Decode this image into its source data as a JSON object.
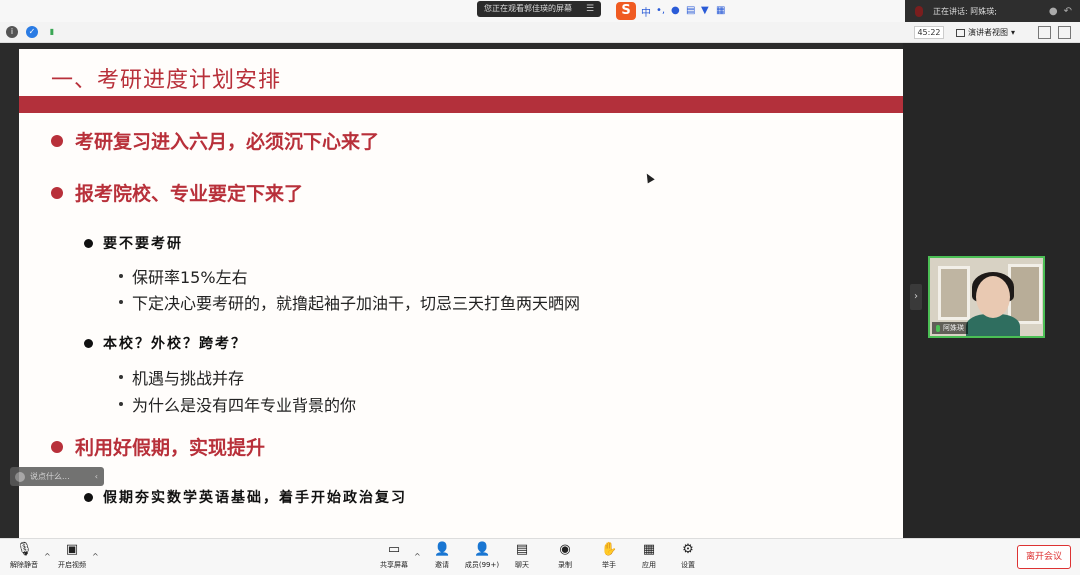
{
  "top": {
    "share_notice": "您正在观看郭佳瑛的屏幕",
    "share_menu": "☰",
    "ime": {
      "logo": "S",
      "mode": "中"
    },
    "speaking_label": "正在讲话: 阿姝瑛;"
  },
  "meeting_bar": {
    "timer": "45:22",
    "view_label": "演讲者视图",
    "view_caret": "▾"
  },
  "slide": {
    "title": "一、考研进度计划安排",
    "sections": [
      {
        "text": "考研复习进入六月，必须沉下心来了"
      },
      {
        "text": "报考院校、专业要定下来了"
      },
      {
        "text": "利用好假期，实现提升"
      }
    ],
    "subsections": [
      {
        "text": "要不要考研",
        "items": [
          "保研率15%左右",
          "下定决心要考研的，就撸起袖子加油干，切忌三天打鱼两天晒网"
        ]
      },
      {
        "text": "本校？外校？跨考？",
        "items": [
          "机遇与挑战并存",
          "为什么是没有四年专业背景的你"
        ]
      },
      {
        "text": "假期夯实数学英语基础，着手开始政治复习",
        "items": []
      }
    ]
  },
  "video": {
    "name": "阿姝瑛"
  },
  "chat_float": {
    "placeholder": "说点什么...",
    "close": "‹"
  },
  "toolbar": {
    "mute": "解除静音",
    "video": "开启视频",
    "share": "共享屏幕",
    "invite": "邀请",
    "members": "成员(99+)",
    "chat": "聊天",
    "record": "录制",
    "raise_hand": "举手",
    "apps": "应用",
    "settings": "设置",
    "leave": "离开会议"
  },
  "colors": {
    "accent_red": "#b8303a",
    "speaking_green": "#4bbf55",
    "leave_red": "#d33333"
  }
}
